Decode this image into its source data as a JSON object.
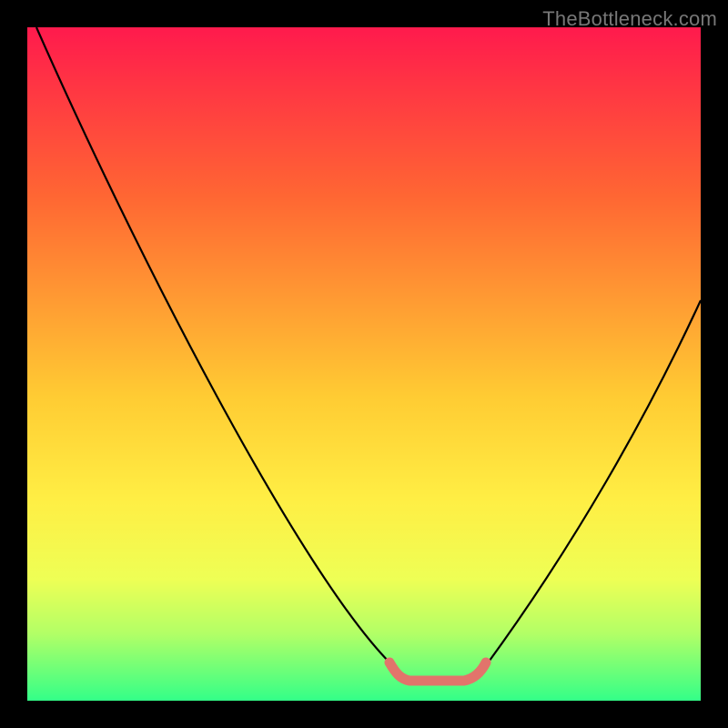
{
  "watermark": "TheBottleneck.com",
  "chart_data": {
    "type": "line",
    "title": "",
    "xlabel": "",
    "ylabel": "",
    "xlim": [
      0,
      100
    ],
    "ylim": [
      0,
      100
    ],
    "grid": false,
    "legend": false,
    "background_gradient": {
      "direction": "vertical",
      "stops": [
        {
          "pos": 0.0,
          "color": "#ff1a4d"
        },
        {
          "pos": 0.25,
          "color": "#ff6633"
        },
        {
          "pos": 0.55,
          "color": "#ffcc33"
        },
        {
          "pos": 0.82,
          "color": "#eeff55"
        },
        {
          "pos": 1.0,
          "color": "#33ff88"
        }
      ]
    },
    "series": [
      {
        "name": "bottleneck-curve",
        "color": "#000000",
        "x": [
          1,
          10,
          20,
          30,
          40,
          50,
          55,
          58,
          65,
          68,
          75,
          85,
          95,
          100
        ],
        "y": [
          100,
          82,
          64,
          46,
          30,
          14,
          6,
          3,
          3,
          6,
          18,
          36,
          52,
          60
        ]
      }
    ],
    "annotations": [
      {
        "name": "optimal-range-highlight",
        "type": "segment",
        "color": "#e2746b",
        "thickness": "thick",
        "x": [
          55,
          67
        ],
        "y": [
          3,
          3
        ]
      }
    ]
  }
}
